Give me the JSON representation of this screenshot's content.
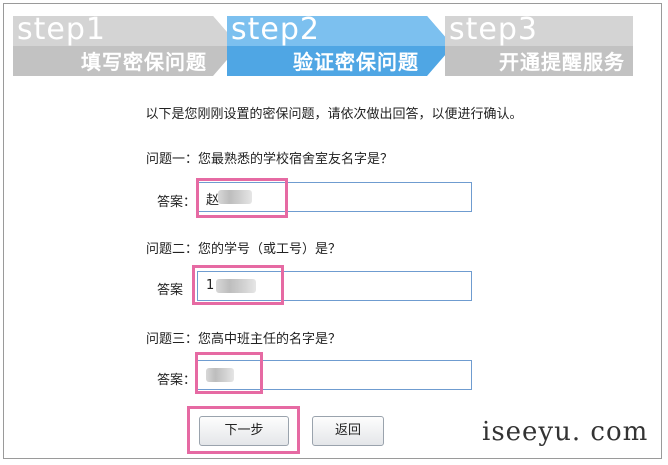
{
  "steps": [
    {
      "num": "step1",
      "name": "填写密保问题",
      "color": "#bfbfbf",
      "active": false
    },
    {
      "num": "step2",
      "name": "验证密保问题",
      "color": "#5aaee8",
      "active": true
    },
    {
      "num": "step3",
      "name": "开通提醒服务",
      "color": "#bfbfbf",
      "active": false
    }
  ],
  "intro": "以下是您刚刚设置的密保问题，请依次做出回答，以便进行确认。",
  "questions": [
    {
      "question": "问题一：您最熟悉的学校宿舍室友名字是？",
      "answer_label": "答案：",
      "answer_value": "赵"
    },
    {
      "question": "问题二：您的学号（或工号）是？",
      "answer_label": "答案",
      "answer_value": "1"
    },
    {
      "question": "问题三：您高中班主任的名字是？",
      "answer_label": "答案：",
      "answer_value": ""
    }
  ],
  "buttons": {
    "next": "下一步",
    "back": "返回"
  },
  "watermark": "iseeyu. com",
  "colors": {
    "highlight": "#e66aa3",
    "input_border": "#6f9cd0"
  }
}
